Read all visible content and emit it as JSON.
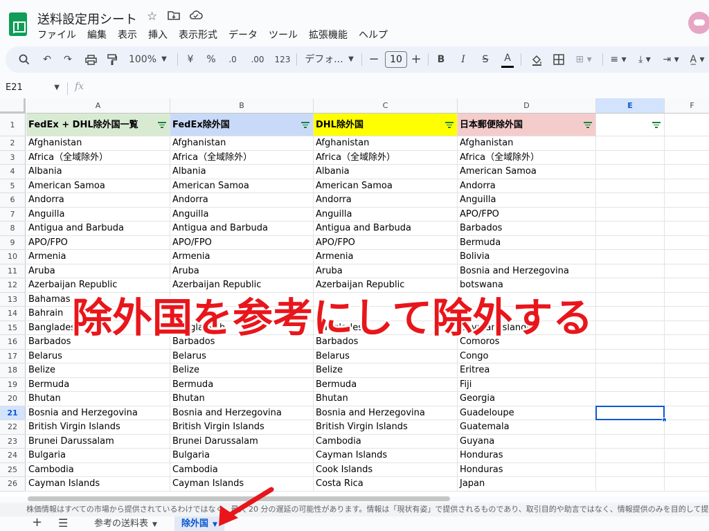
{
  "title_bar": {
    "doc_title": "送料設定用シート",
    "icons": [
      "star-icon",
      "move-to-folder-icon",
      "cloud-status-icon"
    ]
  },
  "menu": [
    "ファイル",
    "編集",
    "表示",
    "挿入",
    "表示形式",
    "データ",
    "ツール",
    "拡張機能",
    "ヘルプ"
  ],
  "toolbar": {
    "zoom": "100%",
    "currency": "¥",
    "percent": "%",
    "decrease_decimal": ".0",
    "increase_decimal": ".00",
    "number_format": "123",
    "font": "デフォ...",
    "font_size": "10",
    "bold": "B",
    "italic": "I",
    "strike": "S",
    "text_color": "A"
  },
  "formula_bar": {
    "name_box": "E21",
    "fx": "fx",
    "content": ""
  },
  "columns": [
    "A",
    "B",
    "C",
    "D",
    "E",
    "F"
  ],
  "selected_column": "E",
  "selected_row": "21",
  "header_row": {
    "row": "1",
    "cells": [
      "FedEx + DHL除外国一覧",
      "FedEx除外国",
      "DHL除外国",
      "日本郵便除外国",
      ""
    ]
  },
  "rows": [
    {
      "n": "2",
      "cells": [
        "Afghanistan",
        "Afghanistan",
        "Afghanistan",
        "Afghanistan"
      ]
    },
    {
      "n": "3",
      "cells": [
        "Africa（全域除外）",
        "Africa（全域除外）",
        "Africa（全域除外）",
        "Africa（全域除外）"
      ]
    },
    {
      "n": "4",
      "cells": [
        "Albania",
        "Albania",
        "Albania",
        "American Samoa"
      ]
    },
    {
      "n": "5",
      "cells": [
        "American Samoa",
        "American Samoa",
        "American Samoa",
        "Andorra"
      ]
    },
    {
      "n": "6",
      "cells": [
        "Andorra",
        "Andorra",
        "Andorra",
        "Anguilla"
      ]
    },
    {
      "n": "7",
      "cells": [
        "Anguilla",
        "Anguilla",
        "Anguilla",
        "APO/FPO"
      ]
    },
    {
      "n": "8",
      "cells": [
        "Antigua and Barbuda",
        "Antigua and Barbuda",
        "Antigua and Barbuda",
        "Barbados"
      ]
    },
    {
      "n": "9",
      "cells": [
        "APO/FPO",
        "APO/FPO",
        "APO/FPO",
        "Bermuda"
      ]
    },
    {
      "n": "10",
      "cells": [
        "Armenia",
        "Armenia",
        "Armenia",
        "Bolivia"
      ]
    },
    {
      "n": "11",
      "cells": [
        "Aruba",
        "Aruba",
        "Aruba",
        "Bosnia and Herzegovina"
      ]
    },
    {
      "n": "12",
      "cells": [
        "Azerbaijan Republic",
        "Azerbaijan Republic",
        "Azerbaijan Republic",
        "botswana"
      ]
    },
    {
      "n": "13",
      "cells": [
        "Bahamas",
        "",
        "",
        ""
      ]
    },
    {
      "n": "14",
      "cells": [
        "Bahrain",
        "",
        "",
        ""
      ]
    },
    {
      "n": "15",
      "cells": [
        "Bangladesh",
        "Bangladesh",
        "Bangladesh",
        "Cayman Islands"
      ]
    },
    {
      "n": "16",
      "cells": [
        "Barbados",
        "Barbados",
        "Barbados",
        "Comoros"
      ]
    },
    {
      "n": "17",
      "cells": [
        "Belarus",
        "Belarus",
        "Belarus",
        "Congo"
      ]
    },
    {
      "n": "18",
      "cells": [
        "Belize",
        "Belize",
        "Belize",
        "Eritrea"
      ]
    },
    {
      "n": "19",
      "cells": [
        "Bermuda",
        "Bermuda",
        "Bermuda",
        "Fiji"
      ]
    },
    {
      "n": "20",
      "cells": [
        "Bhutan",
        "Bhutan",
        "Bhutan",
        "Georgia"
      ]
    },
    {
      "n": "21",
      "cells": [
        "Bosnia and Herzegovina",
        "Bosnia and Herzegovina",
        "Bosnia and Herzegovina",
        "Guadeloupe"
      ]
    },
    {
      "n": "22",
      "cells": [
        "British Virgin Islands",
        "British Virgin Islands",
        "British Virgin Islands",
        "Guatemala"
      ]
    },
    {
      "n": "23",
      "cells": [
        "Brunei Darussalam",
        "Brunei Darussalam",
        "Cambodia",
        "Guyana"
      ]
    },
    {
      "n": "24",
      "cells": [
        "Bulgaria",
        "Bulgaria",
        "Cayman Islands",
        "Honduras"
      ]
    },
    {
      "n": "25",
      "cells": [
        "Cambodia",
        "Cambodia",
        "Cook Islands",
        "Honduras"
      ]
    },
    {
      "n": "26",
      "cells": [
        "Cayman Islands",
        "Cayman Islands",
        "Costa Rica",
        "Japan"
      ]
    }
  ],
  "header_colors": [
    "#d9ead3",
    "#c9daf8",
    "#ffff00",
    "#f4cccc"
  ],
  "overlay_text": "除外国を参考にして除外する",
  "status_text": "株価情報はすべての市場から提供されているわけではなく、最大 20 分の遅延の可能性があります。情報は「現状有姿」で提供されるものであり、取引目的や助言ではなく、情報提供のみを目的して提供されています。",
  "sheet_tabs": [
    {
      "label": "参考の送料表",
      "active": false
    },
    {
      "label": "除外国",
      "active": true
    }
  ]
}
